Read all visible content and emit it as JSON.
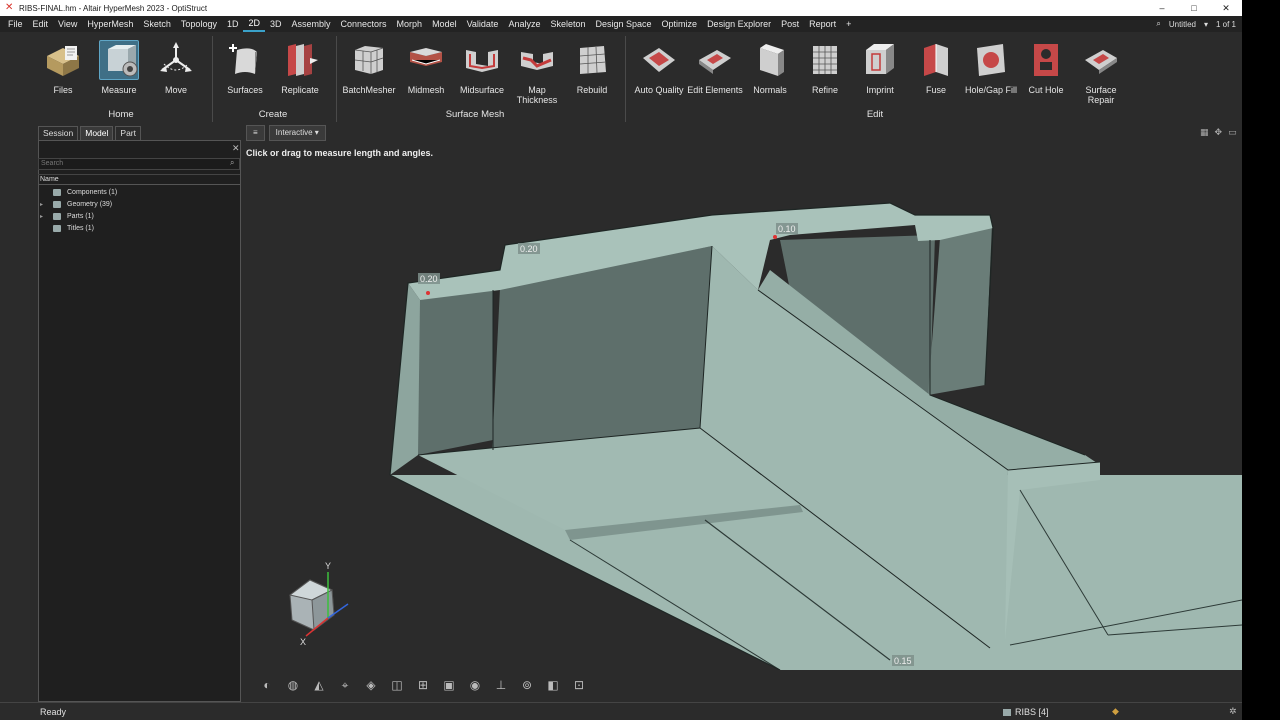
{
  "window": {
    "title": "RIBS-FINAL.hm - Altair HyperMesh 2023 - OptiStruct",
    "controls": [
      "–",
      "□",
      "✕"
    ]
  },
  "menu": {
    "items": [
      "File",
      "Edit",
      "View",
      "HyperMesh",
      "Sketch",
      "Topology",
      "1D",
      "2D",
      "3D",
      "Assembly",
      "Connectors",
      "Morph",
      "Model",
      "Validate",
      "Analyze",
      "Skeleton",
      "Design Space",
      "Optimize",
      "Design Explorer",
      "Post",
      "Report"
    ],
    "active": "2D",
    "add": "+",
    "session_name": "Untitled",
    "page": "1 of 1"
  },
  "ribbon": {
    "tools": [
      {
        "label": "Files"
      },
      {
        "label": "Measure"
      },
      {
        "label": "Move"
      },
      {
        "label": "Surfaces"
      },
      {
        "label": "Replicate"
      },
      {
        "label": "BatchMesher"
      },
      {
        "label": "Midmesh"
      },
      {
        "label": "Midsurface"
      },
      {
        "label": "Map Thickness"
      },
      {
        "label": "Rebuild"
      },
      {
        "label": "Auto Quality"
      },
      {
        "label": "Edit Elements"
      },
      {
        "label": "Normals"
      },
      {
        "label": "Refine"
      },
      {
        "label": "Imprint"
      },
      {
        "label": "Fuse"
      },
      {
        "label": "Hole/Gap Fill"
      },
      {
        "label": "Cut Hole"
      },
      {
        "label": "Surface Repair"
      }
    ],
    "groups": [
      "Home",
      "Create",
      "Surface Mesh",
      "Edit"
    ]
  },
  "browser": {
    "tabs": [
      "Session",
      "Model",
      "Part"
    ],
    "active_tab": "Model",
    "search_placeholder": "Search",
    "column": "Name",
    "rows": [
      {
        "label": "Components",
        "count": "(1)"
      },
      {
        "label": "Geometry",
        "count": "(39)"
      },
      {
        "label": "Parts",
        "count": "(1)"
      },
      {
        "label": "Titles",
        "count": "(1)"
      }
    ]
  },
  "viewport": {
    "mode": "Interactive",
    "hint": "Click or drag to measure length and angles.",
    "labels": [
      "0.20",
      "0.20",
      "0.10",
      "0.15"
    ],
    "axes": {
      "y": "Y",
      "x": "X"
    }
  },
  "status": {
    "text": "Ready",
    "model": "RIBS [4]"
  },
  "colors": {
    "part_face": "#9fb8b0",
    "part_face_dark": "#5e6f6b",
    "background": "#2b2b2b",
    "accent": "#3aa1c9"
  }
}
